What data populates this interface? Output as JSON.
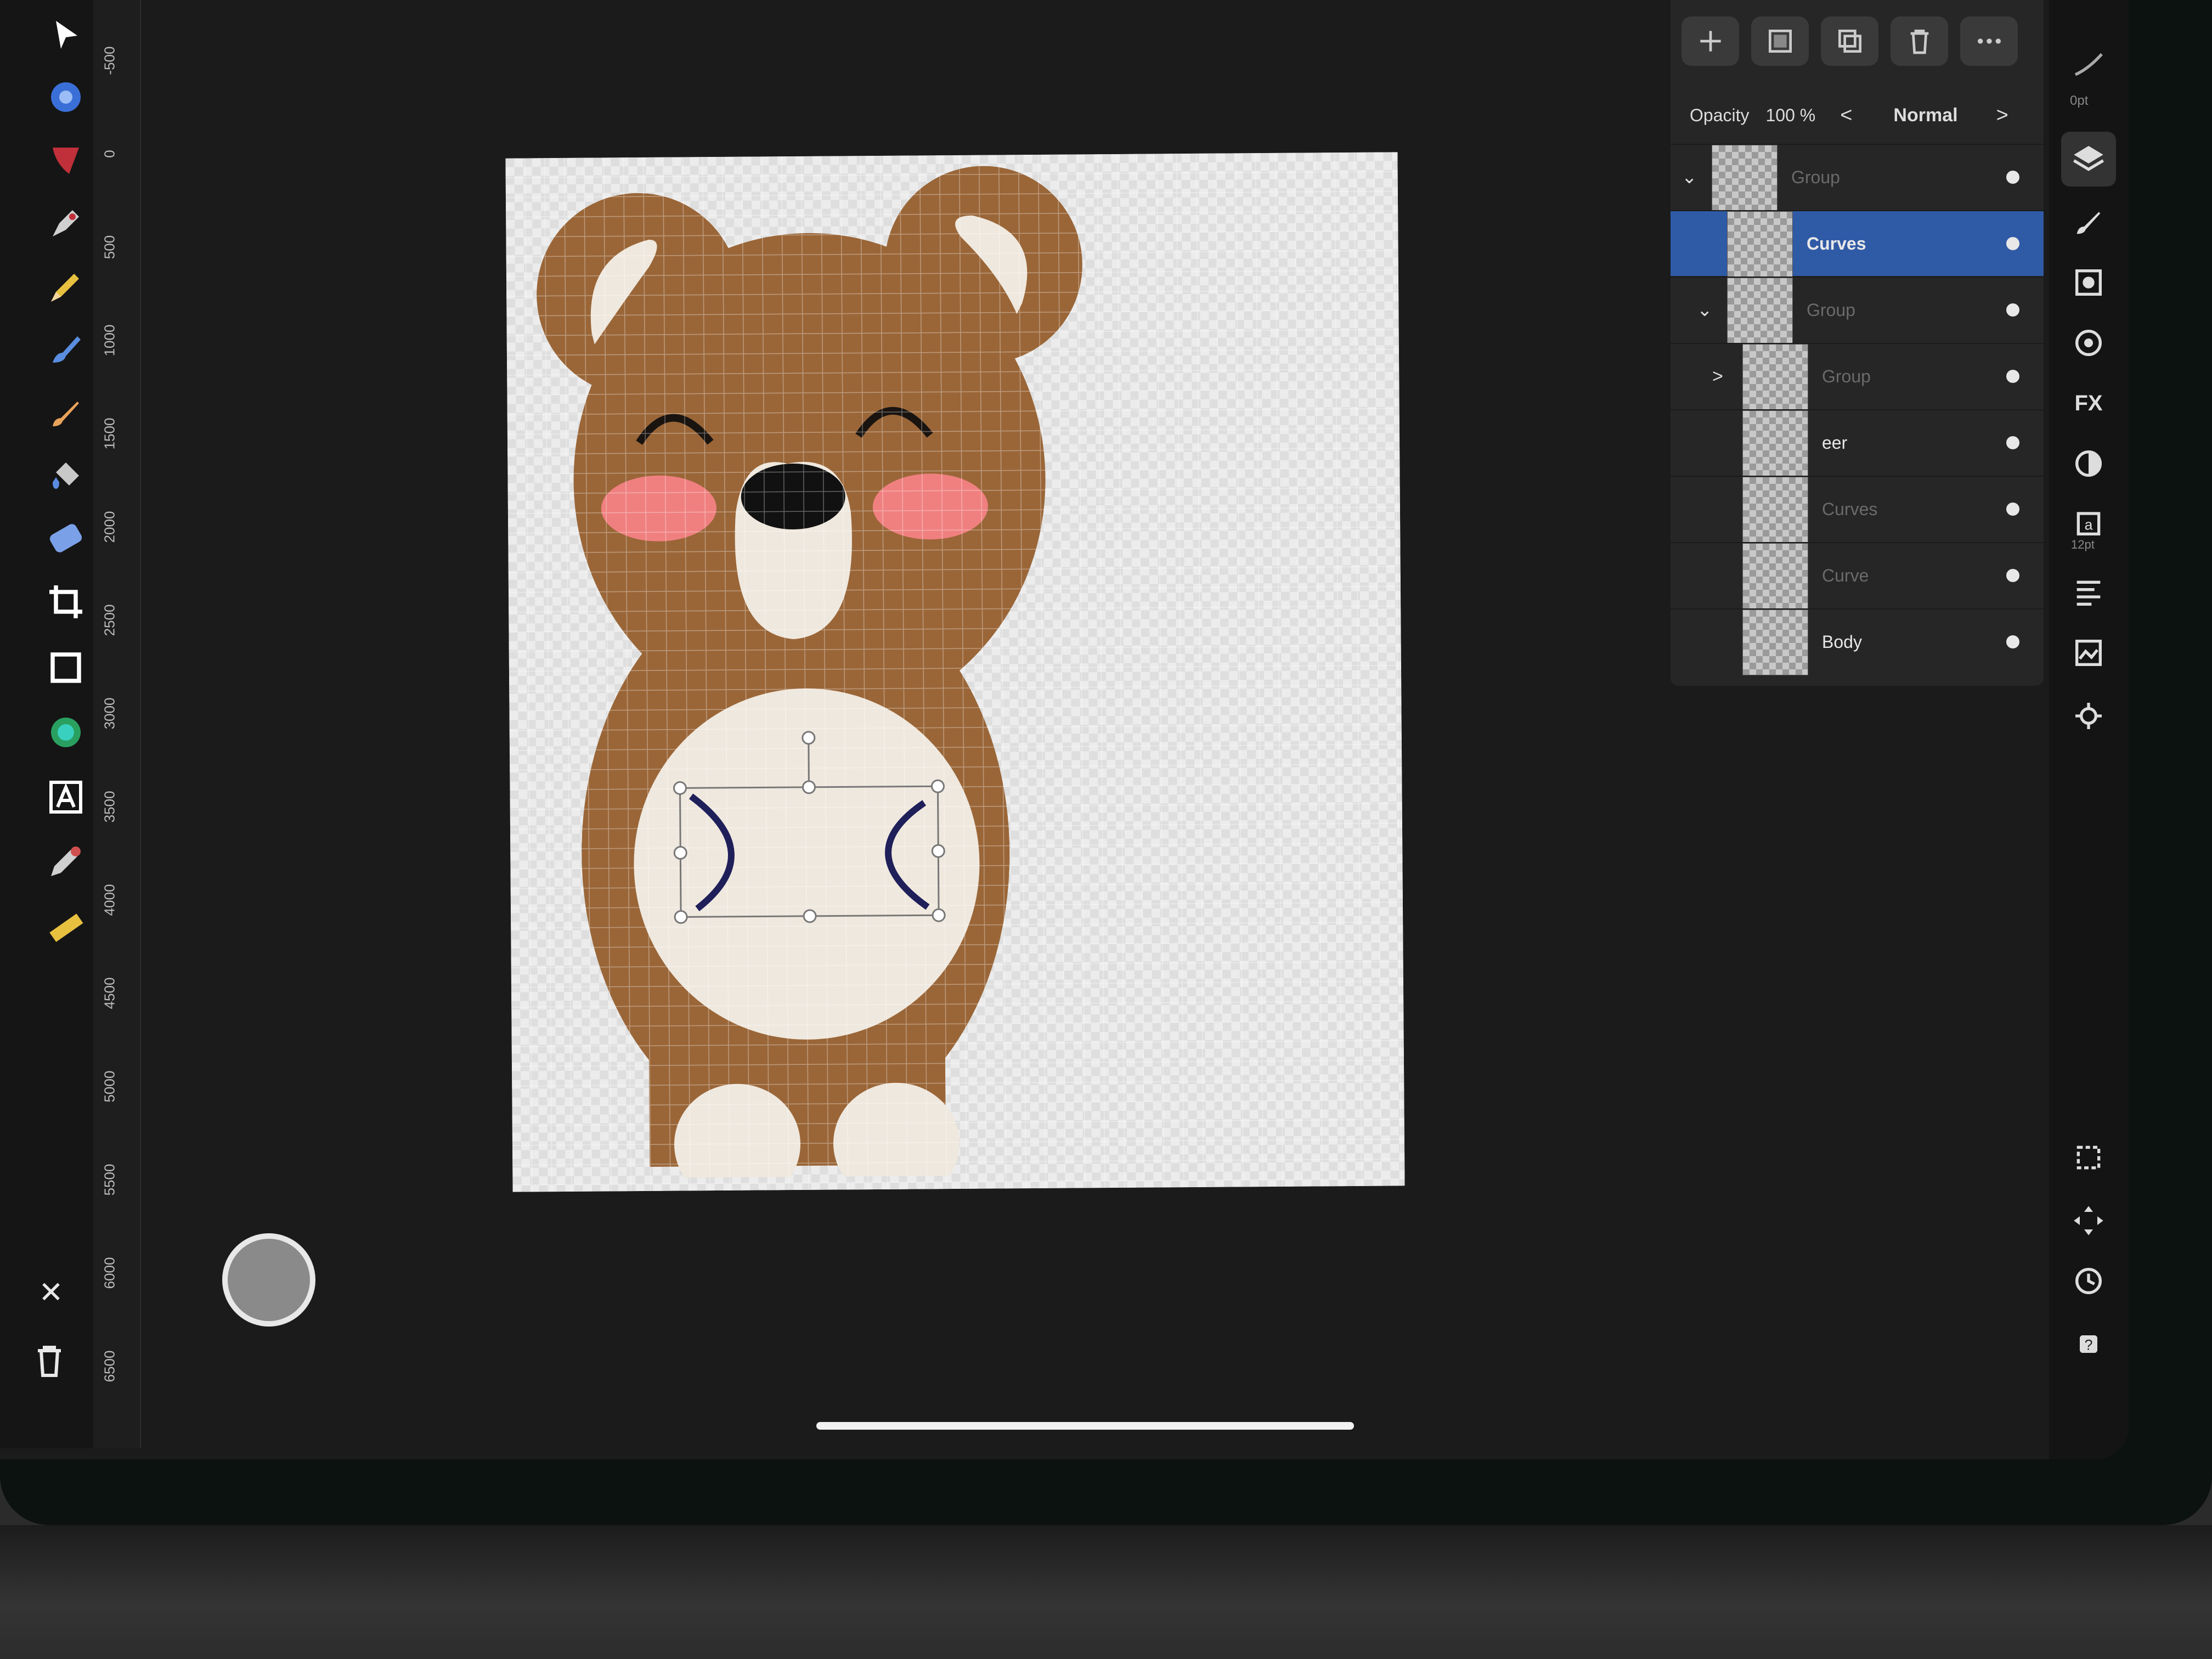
{
  "ruler": {
    "marks": [
      "-500",
      "0",
      "500",
      "1000",
      "1500",
      "2000",
      "2500",
      "3000",
      "3500",
      "4000",
      "4500",
      "5000",
      "5500",
      "6000",
      "6500"
    ]
  },
  "toolbar": {
    "tools": [
      {
        "name": "move-tool-icon"
      },
      {
        "name": "node-tool-icon"
      },
      {
        "name": "corner-tool-icon"
      },
      {
        "name": "pen-tool-icon"
      },
      {
        "name": "pencil-tool-icon"
      },
      {
        "name": "vector-brush-tool-icon"
      },
      {
        "name": "paint-brush-tool-icon"
      },
      {
        "name": "fill-tool-icon"
      },
      {
        "name": "transparency-tool-icon"
      },
      {
        "name": "crop-tool-icon"
      },
      {
        "name": "rectangle-tool-icon"
      },
      {
        "name": "shape-tool-icon"
      },
      {
        "name": "text-tool-icon"
      },
      {
        "name": "color-picker-tool-icon"
      },
      {
        "name": "measure-tool-icon"
      }
    ],
    "close_glyph": "✕"
  },
  "layers_panel": {
    "opacity_label": "Opacity",
    "opacity_value": "100 %",
    "blend_mode": "Normal",
    "prev_glyph": "<",
    "next_glyph": ">",
    "layers": [
      {
        "name": "Group",
        "dim": true,
        "selected": false,
        "caret": "⌄",
        "indent": 0
      },
      {
        "name": "Curves",
        "dim": false,
        "selected": true,
        "caret": "",
        "indent": 1
      },
      {
        "name": "Group",
        "dim": true,
        "selected": false,
        "caret": "⌄",
        "indent": 1
      },
      {
        "name": "Group",
        "dim": true,
        "selected": false,
        "caret": ">",
        "indent": 2
      },
      {
        "name": "eer",
        "dim": false,
        "selected": false,
        "caret": "",
        "indent": 2
      },
      {
        "name": "Curves",
        "dim": true,
        "selected": false,
        "caret": "",
        "indent": 2
      },
      {
        "name": "Curve",
        "dim": true,
        "selected": false,
        "caret": "",
        "indent": 2
      },
      {
        "name": "Body",
        "dim": false,
        "selected": false,
        "caret": "",
        "indent": 2
      }
    ]
  },
  "context": {
    "stroke_width_label": "0pt",
    "text_size_label": "12pt"
  },
  "colors": {
    "bear_brown": "#9a6638",
    "bear_cream": "#efe8de",
    "cheek_pink": "#f08080",
    "selection_blue": "#2f5aa6",
    "curve_stroke": "#1f1f5a"
  }
}
